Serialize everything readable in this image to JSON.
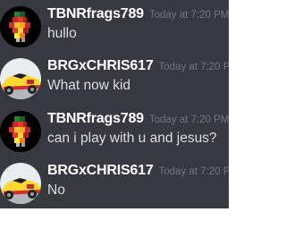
{
  "messages": [
    {
      "username": "TBNRfrags789",
      "timestamp": "Today at 7:20 PM",
      "content": "hullo",
      "avatar": "pixel-character-avatar"
    },
    {
      "username": "BRGxCHRIS617",
      "timestamp": "Today at 7:20 PM",
      "content": "What now kid",
      "avatar": "race-car-avatar"
    },
    {
      "username": "TBNRfrags789",
      "timestamp": "Today at 7:20 PM",
      "content": "can i play with u and jesus?",
      "avatar": "pixel-character-avatar"
    },
    {
      "username": "BRGxCHRIS617",
      "timestamp": "Today at 7:20 PM",
      "content": "No",
      "avatar": "race-car-avatar"
    }
  ],
  "colors": {
    "chat_background": "#36393f",
    "username": "#ffffff",
    "timestamp": "#72767d",
    "message_text": "#dcddde"
  }
}
